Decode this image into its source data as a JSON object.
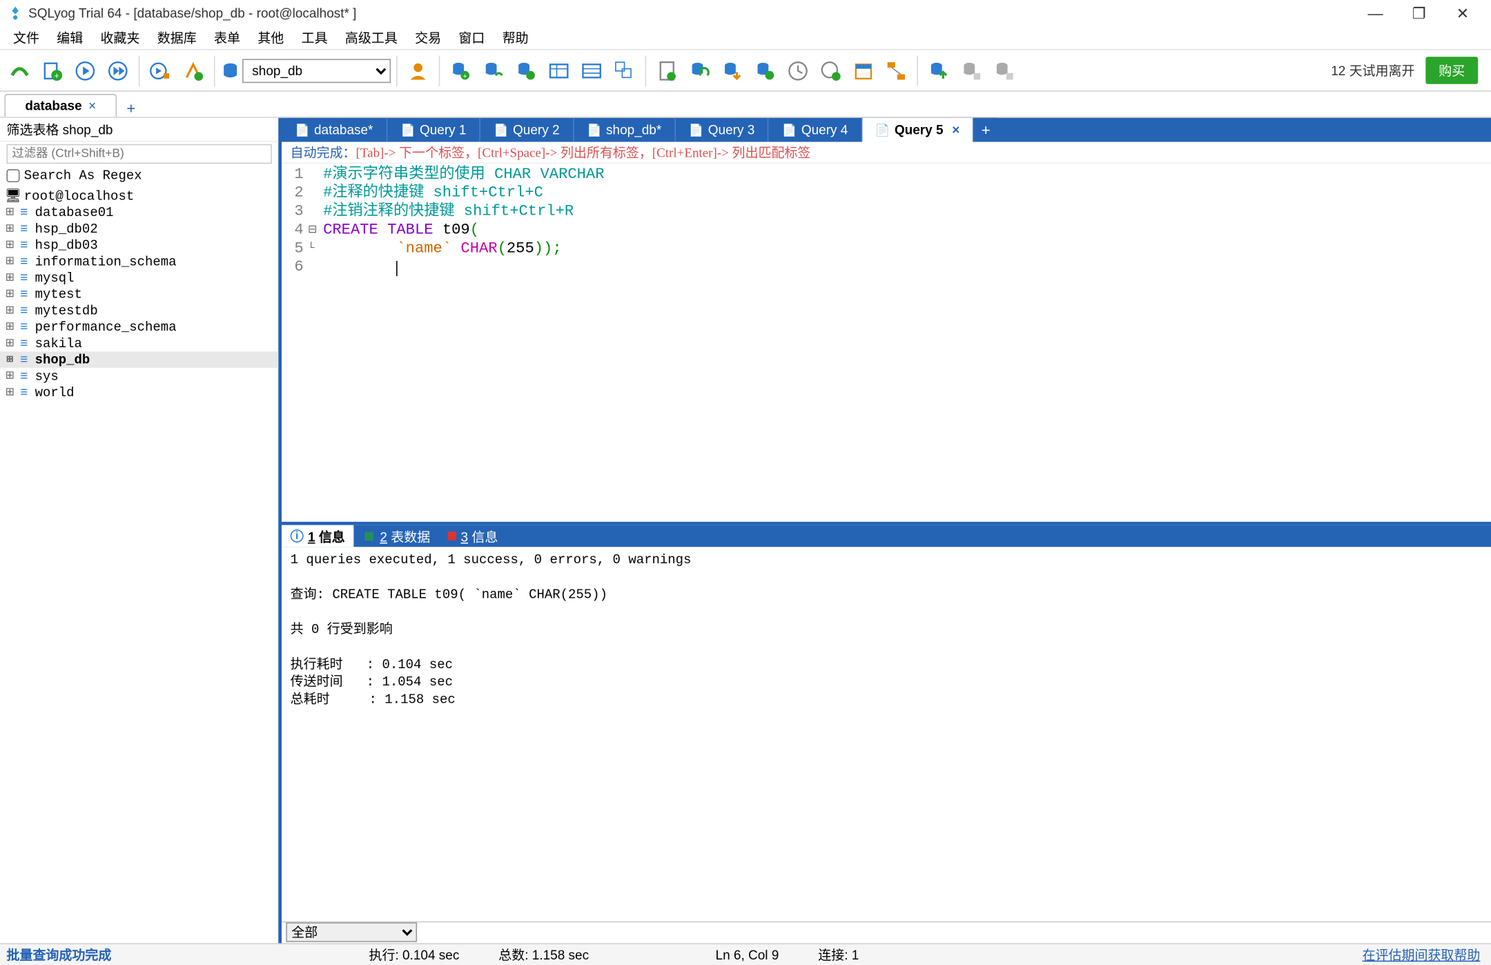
{
  "window": {
    "title": "SQLyog Trial 64 - [database/shop_db - root@localhost* ]"
  },
  "menu": [
    "文件",
    "编辑",
    "收藏夹",
    "数据库",
    "表单",
    "其他",
    "工具",
    "高级工具",
    "交易",
    "窗口",
    "帮助"
  ],
  "toolbar": {
    "db_selected": "shop_db",
    "trial_label": "12 天试用离开",
    "buy_label": "购买"
  },
  "conn_tabs": {
    "items": [
      {
        "label": "database"
      }
    ],
    "add": "+"
  },
  "sidebar": {
    "header": "筛选表格 shop_db",
    "filter_placeholder": "过滤器 (Ctrl+Shift+B)",
    "regex_label": "Search As Regex",
    "root": "root@localhost",
    "dbs": [
      "database01",
      "hsp_db02",
      "hsp_db03",
      "information_schema",
      "mysql",
      "mytest",
      "mytestdb",
      "performance_schema",
      "sakila",
      "shop_db",
      "sys",
      "world"
    ],
    "selected": "shop_db"
  },
  "query_tabs": {
    "items": [
      {
        "label": "database*"
      },
      {
        "label": "Query 1"
      },
      {
        "label": "Query 2"
      },
      {
        "label": "shop_db*"
      },
      {
        "label": "Query 3"
      },
      {
        "label": "Query 4"
      },
      {
        "label": "Query 5",
        "active": true
      }
    ],
    "add": "+"
  },
  "editor": {
    "hint_auto": "自动完成：",
    "hint_tab": "[Tab]-> 下一个标签，",
    "hint_cs": "[Ctrl+Space]-> 列出所有标签，",
    "hint_ce": "[Ctrl+Enter]-> 列出匹配标签",
    "lines": {
      "l1": "#演示字符串类型的使用 CHAR VARCHAR",
      "l2": "#注释的快捷键 shift+Ctrl+C",
      "l3": "#注销注释的快捷键 shift+Ctrl+R",
      "l4_kw": "CREATE TABLE",
      "l4_rest": " t09",
      "l4_paren": "(",
      "l5_ident": "`name`",
      "l5_func": "CHAR",
      "l5_num": "255",
      "l5_close": "));"
    },
    "line_numbers": [
      "1",
      "2",
      "3",
      "4",
      "5",
      "6"
    ]
  },
  "result_tabs": {
    "items": [
      {
        "num": "1",
        "label": "信息",
        "active": true,
        "color": "blue"
      },
      {
        "num": "2",
        "label": "表数据",
        "color": "green"
      },
      {
        "num": "3",
        "label": "信息",
        "color": "red"
      }
    ]
  },
  "result_body": "1 queries executed, 1 success, 0 errors, 0 warnings\n\n查询: CREATE TABLE t09( `name` CHAR(255))\n\n共 0 行受到影响\n\n执行耗时   : 0.104 sec\n传送时间   : 1.054 sec\n总耗时     : 1.158 sec",
  "result_footer_select": "全部",
  "statusbar": {
    "msg": "批量查询成功完成",
    "exec": "执行: 0.104 sec",
    "total": "总数: 1.158 sec",
    "pos": "Ln 6, Col 9",
    "conn": "连接:  1",
    "help": "在评估期间获取帮助"
  }
}
